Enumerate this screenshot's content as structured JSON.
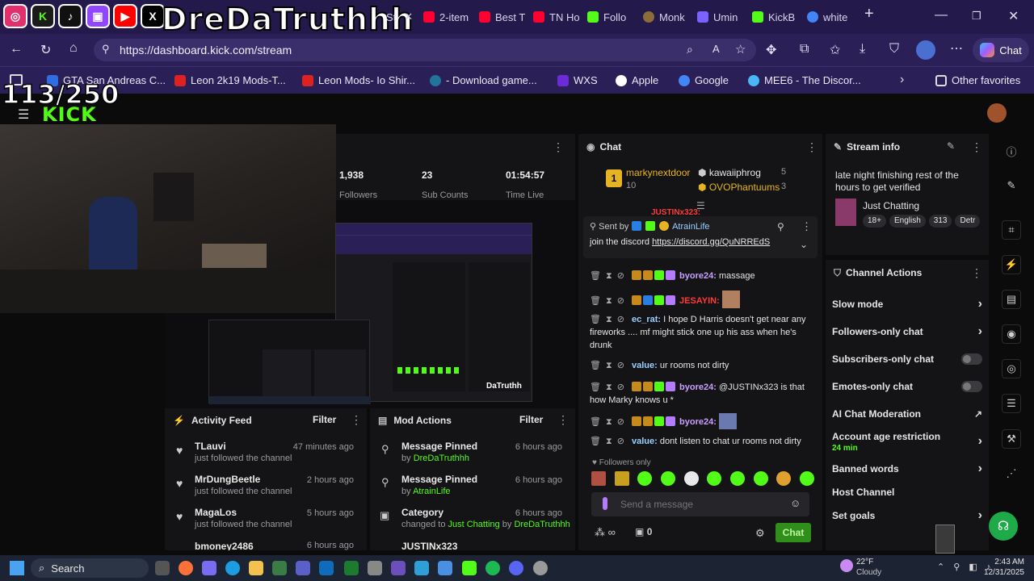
{
  "overlay": {
    "channel_name": "DreDaTruthhh",
    "goal_counter": "113/250",
    "social_icons": [
      "instagram-icon",
      "kick-icon",
      "tiktok-icon",
      "twitch-icon",
      "youtube-icon",
      "x-icon"
    ]
  },
  "browser": {
    "tabs": [
      {
        "label": "St",
        "icon": "kick-icon",
        "color": "#53fc18"
      },
      {
        "label": "2-item",
        "icon": "youtube-icon",
        "color": "#ff0033"
      },
      {
        "label": "Best T",
        "icon": "youtube-icon",
        "color": "#ff0033"
      },
      {
        "label": "TN Ho",
        "icon": "youtube-icon",
        "color": "#ff0033"
      },
      {
        "label": "Follo",
        "icon": "kick-icon",
        "color": "#53fc18"
      },
      {
        "label": "Monk",
        "icon": "monkey-icon",
        "color": "#8a6d3b"
      },
      {
        "label": "Umin",
        "icon": "bot-icon",
        "color": "#7b61ff"
      },
      {
        "label": "KickB",
        "icon": "kickbot-icon",
        "color": "#53fc18"
      },
      {
        "label": "white",
        "icon": "google-icon",
        "color": "#4285f4"
      }
    ],
    "url": "https://dashboard.kick.com/stream",
    "chat_button": "Chat",
    "bookmarks": [
      {
        "label": "GTA San Andreas C...",
        "color": "#2f6de1"
      },
      {
        "label": "Leon 2k19 Mods-T...",
        "color": "#d22"
      },
      {
        "label": "Leon Mods- Io Shir...",
        "color": "#d22"
      },
      {
        "label": "- Download game...",
        "color": "#21759b"
      },
      {
        "label": "WXS",
        "color": "#6c2bd9"
      },
      {
        "label": "Apple",
        "color": "#111"
      },
      {
        "label": "Google",
        "color": "#4285f4"
      },
      {
        "label": "MEE6 - The Discor...",
        "color": "#49b6f5"
      }
    ],
    "other_favorites": "Other favorites"
  },
  "stats": {
    "followers": "1,938",
    "followers_label": "Followers",
    "subs": "23",
    "subs_label": "Sub Counts",
    "time": "01:54:57",
    "time_label": "Time Live"
  },
  "activity_feed": {
    "title": "Activity Feed",
    "filter": "Filter",
    "items": [
      {
        "name": "TLauvi",
        "sub": "just followed the channel",
        "time": "47 minutes ago"
      },
      {
        "name": "MrDungBeetle",
        "sub": "just followed the channel",
        "time": "2 hours ago"
      },
      {
        "name": "MagaLos",
        "sub": "just followed the channel",
        "time": "5 hours ago"
      },
      {
        "name": "bmoney2486",
        "sub": "",
        "time": "6 hours ago"
      }
    ]
  },
  "mod_actions": {
    "title": "Mod Actions",
    "filter": "Filter",
    "items": [
      {
        "title": "Message Pinned",
        "prefix": "by",
        "by": "DreDaTruthhh",
        "time": "6 hours ago"
      },
      {
        "title": "Message Pinned",
        "prefix": "by",
        "by": "AtrainLife",
        "time": "6 hours ago"
      },
      {
        "title": "Category",
        "prefix": "changed to",
        "by": "Just Chatting",
        "by2_prefix": "by",
        "by2": "DreDaTruthhh",
        "time": "6 hours ago"
      },
      {
        "title": "JUSTINx323",
        "prefix": "",
        "by": "",
        "time": ""
      }
    ]
  },
  "chat": {
    "title": "Chat",
    "leaderboard": [
      {
        "rank": "1",
        "name": "markynextdoor",
        "count": "10"
      },
      {
        "name": "kawaiiphrog",
        "count": "5"
      },
      {
        "name": "OVOPhantuums",
        "count": "3"
      }
    ],
    "pinned": {
      "sent_by_label": "Sent by",
      "sent_by": "AtrainLife",
      "text": "join the discord",
      "link": "https://discord.gg/QuNRREdS"
    },
    "partial_user": "JUSTINx323:",
    "messages": [
      {
        "user": "byore24:",
        "text": "massage",
        "user_color": "#c8a0ff"
      },
      {
        "user": "JESAYIN:",
        "text": "",
        "user_color": "#ff3b3b"
      },
      {
        "user": "ec_rat:",
        "text": "I hope D Harris doesn't get near any fireworks .... mf might stick one up his ass when he's drunk",
        "user_color": "#9bd0ff"
      },
      {
        "user": "value:",
        "text": "ur rooms not dirty",
        "user_color": "#9bd0ff"
      },
      {
        "user": "byore24:",
        "text": "@JUSTINx323 is that how Marky knows u *",
        "user_color": "#c8a0ff"
      },
      {
        "user": "byore24:",
        "text": "",
        "user_color": "#c8a0ff"
      },
      {
        "user": "value:",
        "text": "dont listen to chat ur rooms not dirty",
        "user_color": "#9bd0ff"
      }
    ],
    "followers_only": "Followers only",
    "placeholder": "Send a message",
    "points": "0",
    "send": "Chat"
  },
  "stream_info": {
    "title": "Stream info",
    "stream_title": "late night finishing rest of the hours to get verified",
    "category": "Just Chatting",
    "tags": [
      "18+",
      "English",
      "313",
      "Detr"
    ]
  },
  "channel_actions": {
    "title": "Channel Actions",
    "items": [
      {
        "label": "Slow mode",
        "type": "chevron"
      },
      {
        "label": "Followers-only chat",
        "type": "chevron"
      },
      {
        "label": "Subscribers-only chat",
        "type": "toggle"
      },
      {
        "label": "Emotes-only chat",
        "type": "toggle"
      },
      {
        "label": "AI Chat Moderation",
        "type": "external"
      },
      {
        "label": "Account age restriction",
        "sub": "24 min",
        "type": "chevron"
      },
      {
        "label": "Banned words",
        "type": "chevron"
      },
      {
        "label": "Host Channel",
        "type": "none"
      },
      {
        "label": "Set goals",
        "type": "chevron"
      }
    ]
  },
  "taskbar": {
    "search": "Search",
    "weather_temp": "22°F",
    "weather_desc": "Cloudy",
    "time": "2:43 AM",
    "date": "12/31/2025"
  },
  "colors": {
    "kick_green": "#53fc18",
    "browser_bg": "#2a1f57",
    "panel_bg": "#141416"
  }
}
